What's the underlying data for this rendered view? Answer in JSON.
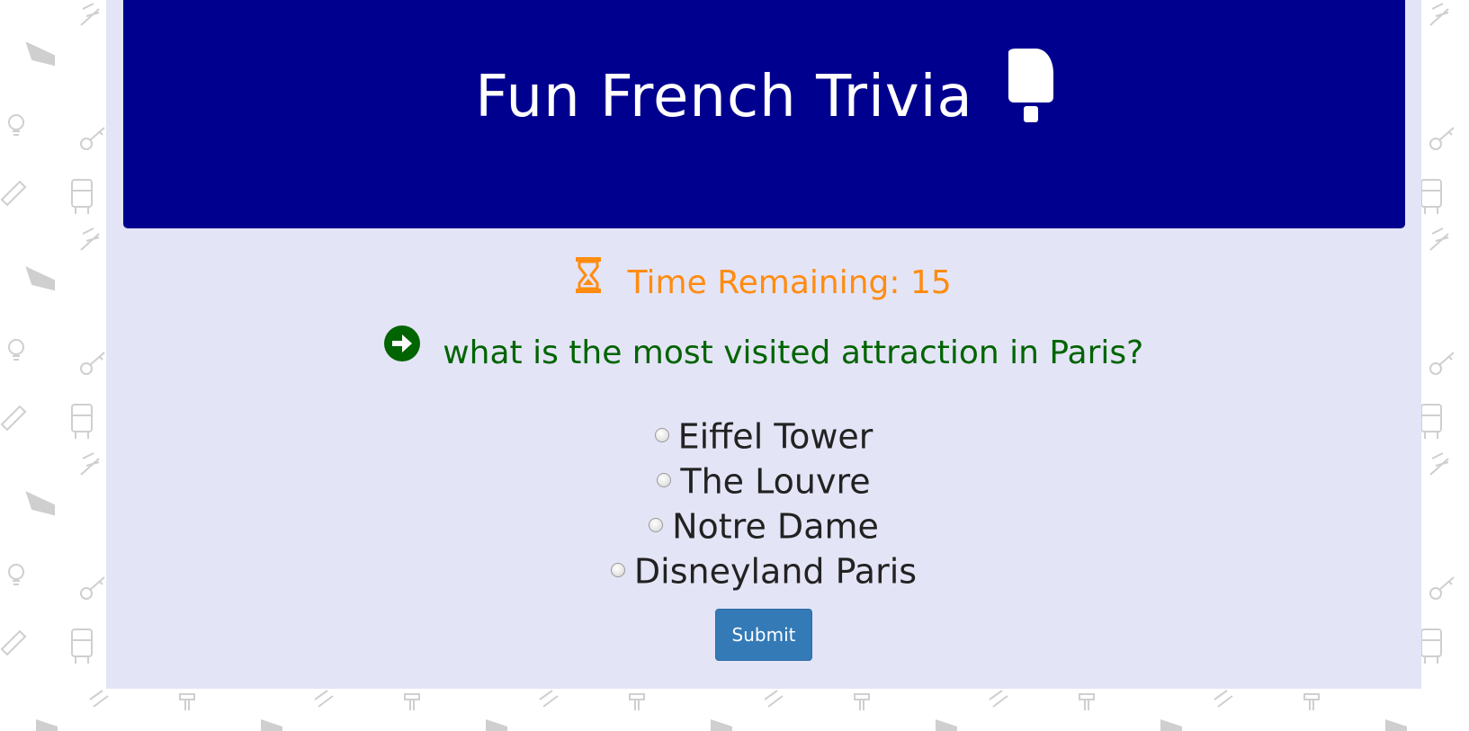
{
  "header": {
    "title": "Fun French Trivia",
    "icon": "popsicle-icon"
  },
  "timer": {
    "icon": "hourglass-icon",
    "text": "Time Remaining: 15"
  },
  "question": {
    "icon": "arrow-circle-right-icon",
    "text": "what is the most visited attraction in Paris?"
  },
  "answers": [
    {
      "label": "Eiffel Tower"
    },
    {
      "label": "The Louvre"
    },
    {
      "label": "Notre Dame"
    },
    {
      "label": "Disneyland Paris"
    }
  ],
  "submit": {
    "label": "Submit"
  },
  "colors": {
    "header_bg": "#00008f",
    "panel_bg": "#e4e4f7",
    "timer": "#ff8c10",
    "question": "#006400",
    "button": "#337ab7"
  }
}
